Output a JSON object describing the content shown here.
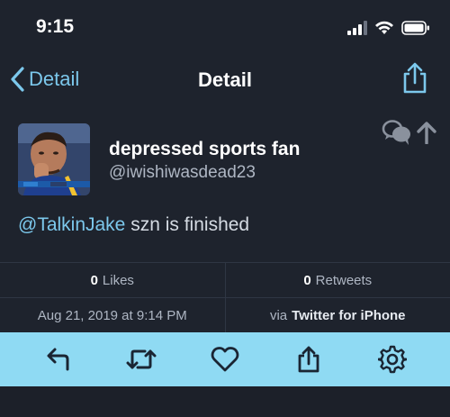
{
  "status_bar": {
    "time": "9:15"
  },
  "nav": {
    "back_label": "Detail",
    "title": "Detail"
  },
  "tweet": {
    "author_name": "depressed sports fan",
    "author_handle": "@iwishiwasdead23",
    "mention": "@TalkinJake",
    "body": " szn is finished"
  },
  "stats": {
    "likes_count": "0",
    "likes_label": "Likes",
    "retweets_count": "0",
    "retweets_label": "Retweets"
  },
  "meta": {
    "timestamp": "Aug 21, 2019 at 9:14 PM",
    "via_label": "via",
    "source": "Twitter for iPhone"
  },
  "colors": {
    "background": "#1e232d",
    "accent": "#7cc8ec",
    "toolbar": "#8fdaf3"
  },
  "toolbar_icons": [
    "reply-icon",
    "retweet-icon",
    "like-icon",
    "share-icon",
    "settings-icon"
  ]
}
